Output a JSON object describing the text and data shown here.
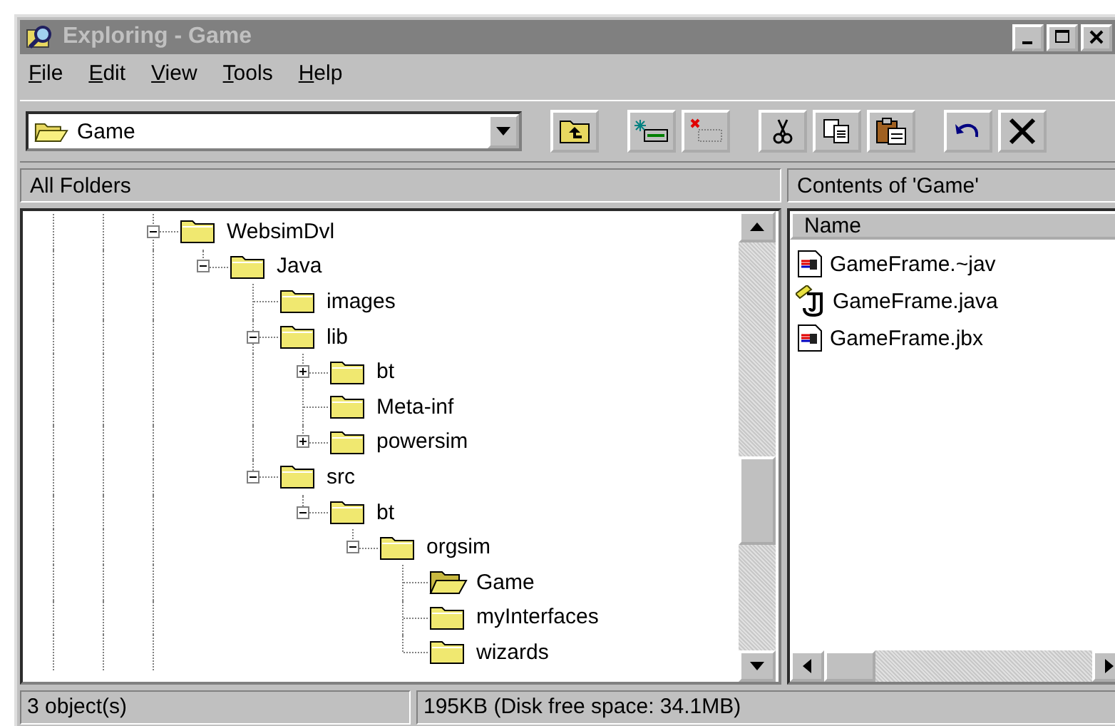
{
  "window": {
    "title": "Exploring - Game",
    "active": false
  },
  "menu": [
    {
      "label": "File"
    },
    {
      "label": "Edit"
    },
    {
      "label": "View"
    },
    {
      "label": "Tools"
    },
    {
      "label": "Help"
    }
  ],
  "address": {
    "value": "Game"
  },
  "folders_pane": {
    "header": "All Folders",
    "tree": [
      {
        "label": "WebsimDvl",
        "kind": "branch",
        "expanded": true,
        "selected": false,
        "children": [
          {
            "label": "Java",
            "kind": "branch",
            "expanded": true,
            "selected": false,
            "children": [
              {
                "label": "images",
                "kind": "leaf",
                "selected": false
              },
              {
                "label": "lib",
                "kind": "branch",
                "expanded": true,
                "selected": false,
                "children": [
                  {
                    "label": "bt",
                    "kind": "branch",
                    "expanded": false,
                    "selected": false
                  },
                  {
                    "label": "Meta-inf",
                    "kind": "leaf",
                    "selected": false
                  },
                  {
                    "label": "powersim",
                    "kind": "branch",
                    "expanded": false,
                    "selected": false
                  }
                ]
              },
              {
                "label": "src",
                "kind": "branch",
                "expanded": true,
                "selected": false,
                "children": [
                  {
                    "label": "bt",
                    "kind": "branch",
                    "expanded": true,
                    "selected": false,
                    "children": [
                      {
                        "label": "orgsim",
                        "kind": "branch",
                        "expanded": true,
                        "selected": false,
                        "children": [
                          {
                            "label": "Game",
                            "kind": "leaf",
                            "selected": true
                          },
                          {
                            "label": "myInterfaces",
                            "kind": "leaf",
                            "selected": false
                          },
                          {
                            "label": "wizards",
                            "kind": "leaf",
                            "selected": false
                          }
                        ]
                      }
                    ]
                  }
                ]
              }
            ]
          }
        ]
      }
    ]
  },
  "contents_pane": {
    "header": "Contents of 'Game'",
    "columns": [
      "Name"
    ],
    "files": [
      {
        "name": "GameFrame.~jav",
        "kind": "project"
      },
      {
        "name": "GameFrame.java",
        "kind": "java"
      },
      {
        "name": "GameFrame.jbx",
        "kind": "project"
      }
    ]
  },
  "status_bar": [
    "3 object(s)",
    "195KB (Disk free space: 34.1MB)"
  ]
}
